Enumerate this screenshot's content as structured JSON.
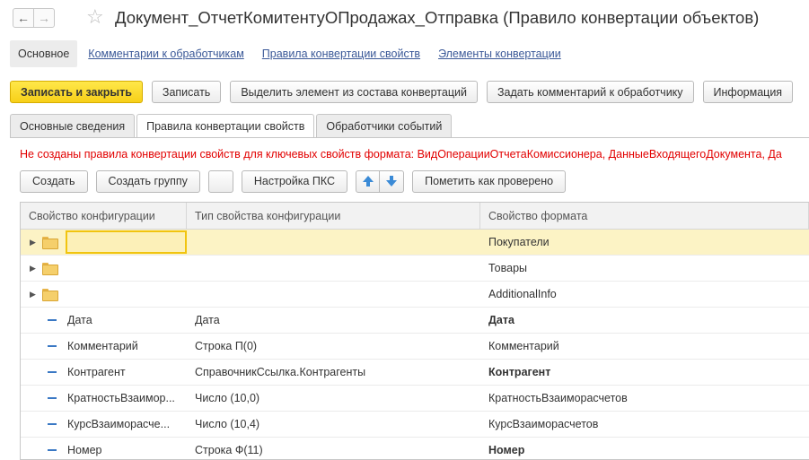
{
  "window": {
    "title": "Документ_ОтчетКомитентуОПродажах_Отправка (Правило конвертации объектов)"
  },
  "nav_panel": {
    "items": [
      "Основное",
      "Комментарии к обработчикам",
      "Правила конвертации свойств",
      "Элементы конвертации"
    ]
  },
  "command_bar": {
    "save_close": "Записать и закрыть",
    "save": "Записать",
    "select_element": "Выделить элемент из состава конвертаций",
    "add_comment": "Задать комментарий к обработчику",
    "info": "Информация"
  },
  "tabs": [
    "Основные сведения",
    "Правила конвертации свойств",
    "Обработчики событий"
  ],
  "active_tab": 1,
  "warning": "Не созданы правила конвертации свойств для ключевых свойств формата: ВидОперацииОтчетаКомиссионера, ДанныеВходящегоДокумента, Да",
  "table_toolbar": {
    "create": "Создать",
    "create_group": "Создать группу",
    "pks_settings": "Настройка ПКС",
    "mark_checked": "Пометить как проверено"
  },
  "grid": {
    "columns": [
      "Свойство конфигурации",
      "Тип свойства конфигурации",
      "Свойство формата"
    ],
    "rows": [
      {
        "kind": "group",
        "config": "",
        "type": "",
        "format": "Покупатели",
        "bold": false
      },
      {
        "kind": "group",
        "config": "",
        "type": "",
        "format": "Товары",
        "bold": false
      },
      {
        "kind": "group",
        "config": "",
        "type": "",
        "format": "AdditionalInfo",
        "bold": false
      },
      {
        "kind": "prop",
        "config": "Дата",
        "type": "Дата",
        "format": "Дата",
        "bold": true
      },
      {
        "kind": "prop",
        "config": "Комментарий",
        "type": "Строка П(0)",
        "format": "Комментарий",
        "bold": false
      },
      {
        "kind": "prop",
        "config": "Контрагент",
        "type": "СправочникСсылка.Контрагенты",
        "format": "Контрагент",
        "bold": true
      },
      {
        "kind": "prop",
        "config": "КратностьВзаимор...",
        "type": "Число (10,0)",
        "format": "КратностьВзаиморасчетов",
        "bold": false
      },
      {
        "kind": "prop",
        "config": "КурсВзаиморасче...",
        "type": "Число (10,4)",
        "format": "КурсВзаиморасчетов",
        "bold": false
      },
      {
        "kind": "prop",
        "config": "Номер",
        "type": "Строка Ф(11)",
        "format": "Номер",
        "bold": true
      }
    ]
  },
  "colors": {
    "accent_yellow": "#f7cf18",
    "selected_row": "#fcf3c5",
    "warning_red": "#e20000",
    "link_blue": "#3b5998"
  },
  "icons": {
    "back": "arrow-left-icon",
    "forward": "arrow-right-icon",
    "favorite": "star-icon",
    "add_copy": "add-copy-icon",
    "move_up": "arrow-up-icon",
    "move_down": "arrow-down-icon",
    "folder": "folder-icon",
    "property": "property-dash-icon"
  }
}
